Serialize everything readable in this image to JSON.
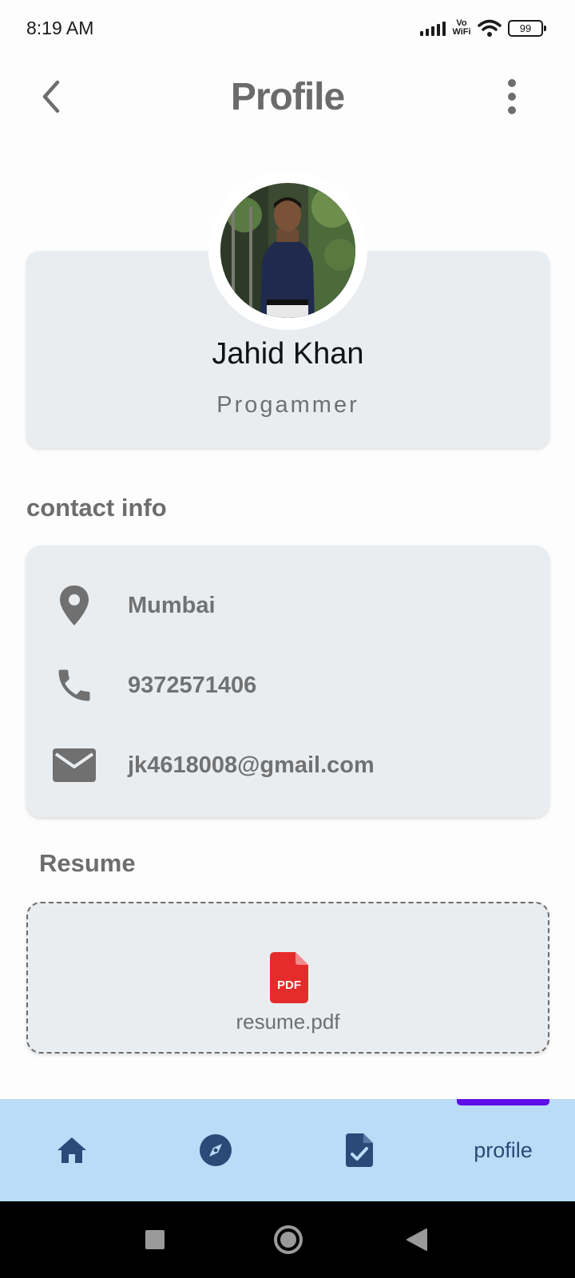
{
  "status_bar": {
    "time": "8:19 AM",
    "network_label": "Vo WiFi",
    "battery": "99"
  },
  "header": {
    "title": "Profile",
    "back_icon": "chevron-left-icon",
    "menu_icon": "more-vert-icon"
  },
  "profile": {
    "name": "Jahid Khan",
    "role": "Progammer"
  },
  "contact": {
    "heading": "contact info",
    "items": [
      {
        "icon": "location-pin-icon",
        "value": "Mumbai"
      },
      {
        "icon": "phone-icon",
        "value": "9372571406"
      },
      {
        "icon": "email-icon",
        "value": "jk4618008@gmail.com"
      }
    ]
  },
  "resume": {
    "heading": "Resume",
    "file_icon_label": "PDF",
    "file_name": "resume.pdf"
  },
  "bottom_nav": {
    "items": [
      {
        "icon": "home-icon"
      },
      {
        "icon": "compass-icon"
      },
      {
        "icon": "document-check-icon"
      },
      {
        "label": "profile"
      }
    ],
    "active_index": 3
  },
  "colors": {
    "card_bg": "#eaedf0",
    "nav_bg": "#bbdcf7",
    "nav_icon": "#2c4a78",
    "active_indicator": "#5f0ee8",
    "pdf_red": "#e62b2b"
  }
}
